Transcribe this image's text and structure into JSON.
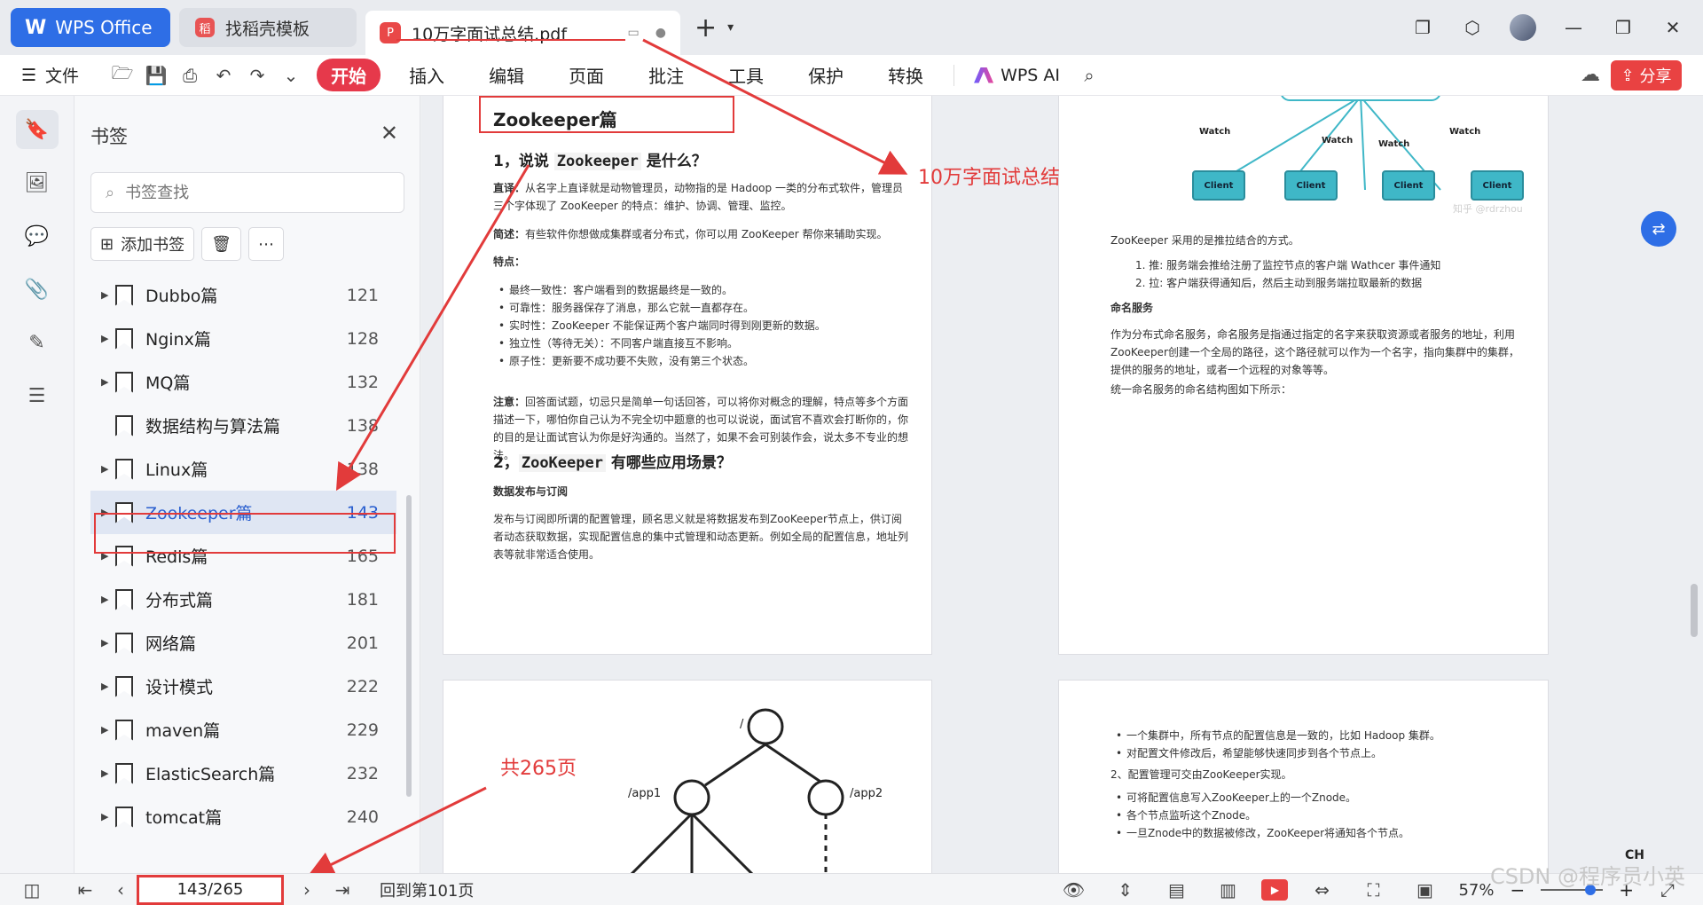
{
  "titlebar": {
    "wps_tab": "WPS Office",
    "template_tab": "找稻壳模板",
    "doc_tab": "10万字面试总结.pdf"
  },
  "ribbon": {
    "file": "文件",
    "tabs": [
      "开始",
      "插入",
      "编辑",
      "页面",
      "批注",
      "工具",
      "保护",
      "转换"
    ],
    "ai": "WPS AI",
    "share": "分享"
  },
  "bookmarks": {
    "title": "书签",
    "search_placeholder": "书签查找",
    "add": "添加书签",
    "items": [
      {
        "label": "Dubbo篇",
        "page": "121"
      },
      {
        "label": "Nginx篇",
        "page": "128"
      },
      {
        "label": "MQ篇",
        "page": "132"
      },
      {
        "label": "数据结构与算法篇",
        "page": "138"
      },
      {
        "label": "Linux篇",
        "page": "138"
      },
      {
        "label": "Zookeeper篇",
        "page": "143"
      },
      {
        "label": "Redis篇",
        "page": "165"
      },
      {
        "label": "分布式篇",
        "page": "181"
      },
      {
        "label": "网络篇",
        "page": "201"
      },
      {
        "label": "设计模式",
        "page": "222"
      },
      {
        "label": "maven篇",
        "page": "229"
      },
      {
        "label": "ElasticSearch篇",
        "page": "232"
      },
      {
        "label": "tomcat篇",
        "page": "240"
      }
    ]
  },
  "page1": {
    "heading": "Zookeeper篇",
    "q1_pre": "1，说说 ",
    "q1_code": "Zookeeper",
    "q1_post": " 是什么？",
    "p1_label": "直译：",
    "p1": "从名字上直译就是动物管理员，动物指的是 Hadoop 一类的分布式软件，管理员三个字体现了 ZooKeeper 的特点：维护、协调、管理、监控。",
    "p2_label": "简述：",
    "p2": "有些软件你想做成集群或者分布式，你可以用 ZooKeeper 帮你来辅助实现。",
    "features_label": "特点：",
    "features": [
      "最终一致性：客户端看到的数据最终是一致的。",
      "可靠性：服务器保存了消息，那么它就一直都存在。",
      "实时性：ZooKeeper 不能保证两个客户端同时得到刚更新的数据。",
      "独立性（等待无关）：不同客户端直接互不影响。",
      "原子性：更新要不成功要不失败，没有第三个状态。"
    ],
    "note_label": "注意：",
    "note": "回答面试题，切忌只是简单一句话回答，可以将你对概念的理解，特点等多个方面描述一下，哪怕你自己认为不完全切中题意的也可以说说，面试官不喜欢会打断你的，你的目的是让面试官认为你是好沟通的。当然了，如果不会可别装作会，说太多不专业的想法。",
    "q2_pre": "2，",
    "q2_code": "ZooKeeper",
    "q2_post": " 有哪些应用场景？",
    "sub": "数据发布与订阅",
    "p3": "发布与订阅即所谓的配置管理，顾名思义就是将数据发布到ZooKeeper节点上，供订阅者动态获取数据，实现配置信息的集中式管理和动态更新。例如全局的配置信息，地址列表等就非常适合使用。"
  },
  "page2": {
    "diagram_watch": [
      "Watch",
      "Watch",
      "Watch",
      "Watch"
    ],
    "diagram_client": [
      "Client",
      "Client",
      "Client",
      "Client"
    ],
    "diagram_credit": "知乎 @rdrzhou",
    "p1": "ZooKeeper 采用的是推拉结合的方式。",
    "ol": [
      "1. 推: 服务端会推给注册了监控节点的客户端 Wathcer 事件通知",
      "2. 拉: 客户端获得通知后，然后主动到服务端拉取最新的数据"
    ],
    "sub": "命名服务",
    "p2": "作为分布式命名服务，命名服务是指通过指定的名字来获取资源或者服务的地址，利用ZooKeeper创建一个全局的路径，这个路径就可以作为一个名字，指向集群中的集群，提供的服务的地址，或者一个远程的对象等等。",
    "p3": "统一命名服务的命名结构图如下所示："
  },
  "page3": {
    "root": "/",
    "app1": "/app1",
    "app2": "/app2"
  },
  "page4": {
    "items": [
      "一个集群中，所有节点的配置信息是一致的，比如 Hadoop 集群。",
      "对配置文件修改后，希望能够快速同步到各个节点上。"
    ],
    "p1": "2、配置管理可交由ZooKeeper实现。",
    "items2": [
      "可将配置信息写入ZooKeeper上的一个Znode。",
      "各个节点监听这个Znode。",
      "一旦Znode中的数据被修改，ZooKeeper将通知各个节点。"
    ]
  },
  "annotations": {
    "title_note": "10万字面试总结",
    "pages_note": "共265页"
  },
  "status": {
    "page_value": "143/265",
    "goto": "回到第101页",
    "zoom": "57%",
    "ime": "CH"
  },
  "watermark": "CSDN @程序员小英",
  "colors": {
    "accent": "#2e6ee6",
    "annotation": "#e23b3b",
    "active_tab": "#e6394b"
  }
}
